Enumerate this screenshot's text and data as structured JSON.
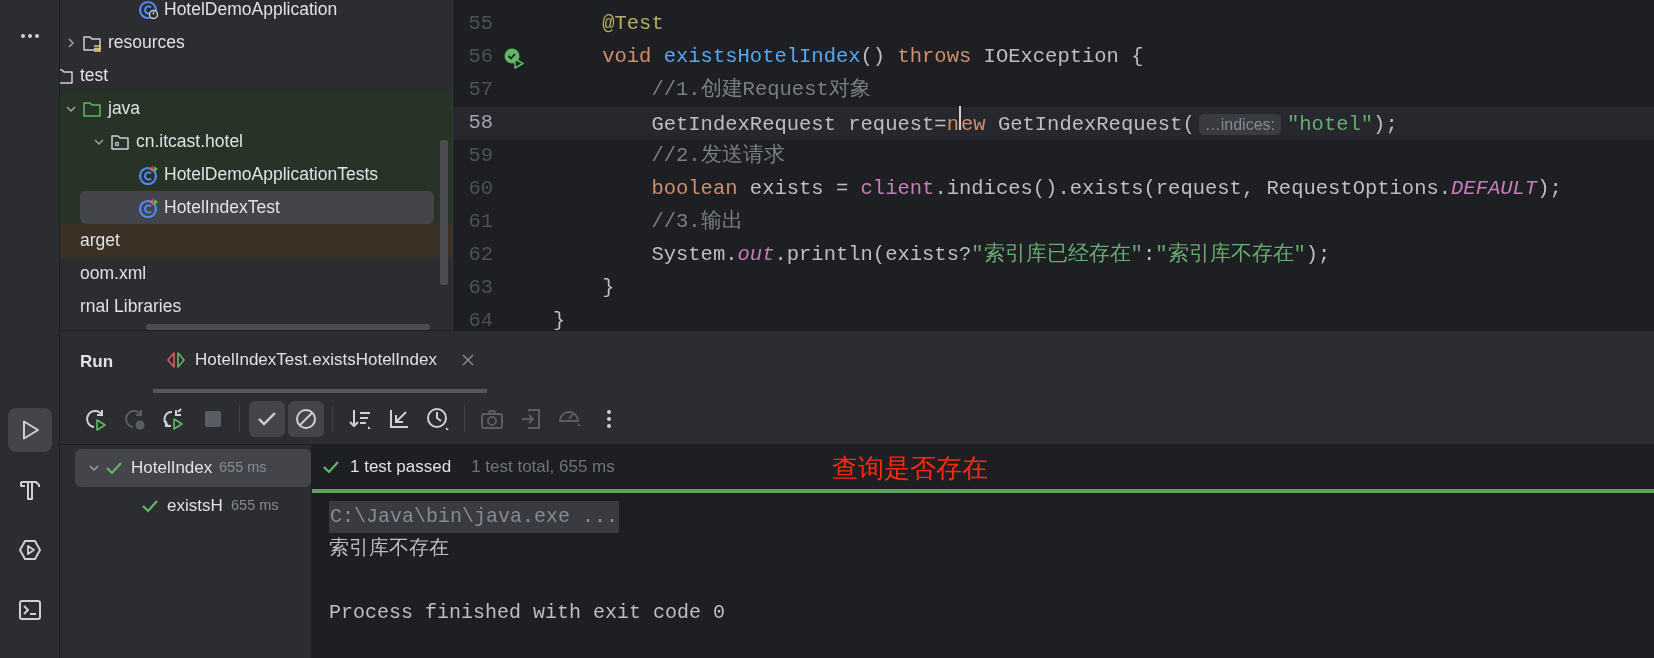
{
  "tool_windows": [
    {
      "kind": "more",
      "selected": false
    },
    {
      "kind": "run",
      "selected": true
    },
    {
      "kind": "build",
      "selected": false
    },
    {
      "kind": "services",
      "selected": false
    },
    {
      "kind": "terminal",
      "selected": false
    }
  ],
  "project_tree": [
    {
      "children": [
        {
          "children": [
            {
              "children": [
                {
                  "label": "HotelDemoApplication",
                  "kind": "app-class"
                }
              ]
            }
          ]
        },
        {
          "label": "resources",
          "kind": "resources-folder",
          "expanded": false
        }
      ]
    },
    {
      "label": "test",
      "kind": "folder",
      "children": [
        {
          "label": "java",
          "kind": "test-folder",
          "expanded": true,
          "children": [
            {
              "label": "cn.itcast.hotel",
              "kind": "package",
              "expanded": true,
              "children": [
                {
                  "label": "HotelDemoApplicationTests",
                  "kind": "test-class",
                  "selected": false
                },
                {
                  "label": "HotelIndexTest",
                  "kind": "test-class",
                  "selected": true
                }
              ]
            }
          ]
        }
      ]
    },
    {
      "label": "arget",
      "kind": "excluded-folder"
    },
    {
      "label": "oom.xml"
    },
    {
      "label": "rnal Libraries"
    }
  ],
  "editor": {
    "lines": [
      {
        "number": "55",
        "current": false,
        "tokens": [
          {
            "kind": "annotation",
            "text": "    @Test"
          }
        ]
      },
      {
        "number": "56",
        "current": false,
        "gutter": {
          "kind": "test-passed"
        },
        "tokens": [
          {
            "kind": "keyword",
            "text": "    void "
          },
          {
            "kind": "method",
            "text": "existsHotelIndex"
          },
          {
            "kind": "plain",
            "text": "() "
          },
          {
            "kind": "keyword",
            "text": "throws "
          },
          {
            "kind": "plain",
            "text": "IOException {"
          }
        ]
      },
      {
        "number": "57",
        "current": false,
        "tokens": [
          {
            "kind": "comment",
            "text": "        //1.创建Request对象"
          }
        ]
      },
      {
        "number": "58",
        "current": true,
        "tokens": [
          {
            "kind": "plain",
            "text": "        GetIndexRequest request="
          },
          {
            "kind": "keyword",
            "text": "n"
          },
          {
            "kind": "caret"
          },
          {
            "kind": "keyword",
            "text": "ew "
          },
          {
            "kind": "plain",
            "text": "GetIndexRequest("
          },
          {
            "kind": "hint",
            "text": "…indices:"
          },
          {
            "kind": "string",
            "text": "\"hotel\""
          },
          {
            "kind": "plain",
            "text": ");"
          }
        ]
      },
      {
        "number": "59",
        "current": false,
        "tokens": [
          {
            "kind": "comment",
            "text": "        //2.发送请求"
          }
        ]
      },
      {
        "number": "60",
        "current": false,
        "tokens": [
          {
            "kind": "keyword",
            "text": "        boolean "
          },
          {
            "kind": "plain",
            "text": "exists = "
          },
          {
            "kind": "field",
            "text": "client"
          },
          {
            "kind": "plain",
            "text": ".indices().exists(request, RequestOptions."
          },
          {
            "kind": "static",
            "text": "DEFAULT"
          },
          {
            "kind": "plain",
            "text": ");"
          }
        ]
      },
      {
        "number": "61",
        "current": false,
        "tokens": [
          {
            "kind": "comment",
            "text": "        //3.输出"
          }
        ]
      },
      {
        "number": "62",
        "current": false,
        "tokens": [
          {
            "kind": "plain",
            "text": "        System."
          },
          {
            "kind": "static",
            "text": "out"
          },
          {
            "kind": "plain",
            "text": ".println(exists?"
          },
          {
            "kind": "string",
            "text": "\"索引库已经存在\""
          },
          {
            "kind": "plain",
            "text": ":"
          },
          {
            "kind": "string",
            "text": "\"索引库不存在\""
          },
          {
            "kind": "plain",
            "text": ");"
          }
        ]
      },
      {
        "number": "63",
        "current": false,
        "tokens": [
          {
            "kind": "plain",
            "text": "    }"
          }
        ]
      },
      {
        "number": "64",
        "current": false,
        "tokens": [
          {
            "kind": "plain",
            "text": "}"
          }
        ]
      }
    ]
  },
  "run_panel": {
    "title": "Run",
    "tabs": [
      {
        "label": "HotelIndexTest.existsHotelIndex",
        "selected": true
      }
    ],
    "toolbar_groups": [
      [
        {
          "kind": "rerun",
          "disabled": false,
          "on": false
        },
        {
          "kind": "rerun-failed",
          "disabled": true,
          "on": false
        },
        {
          "kind": "auto-test",
          "disabled": false,
          "on": false
        },
        {
          "kind": "stop",
          "disabled": true,
          "on": false
        }
      ],
      [
        {
          "kind": "show-passed",
          "disabled": false,
          "on": true
        },
        {
          "kind": "show-ignored",
          "disabled": false,
          "on": true
        }
      ],
      [
        {
          "kind": "sort",
          "disabled": false,
          "on": false
        },
        {
          "kind": "collapse",
          "disabled": false,
          "on": false
        },
        {
          "kind": "history",
          "disabled": false,
          "on": false
        }
      ],
      [
        {
          "kind": "camera",
          "disabled": true,
          "on": false
        },
        {
          "kind": "import",
          "disabled": true,
          "on": false
        },
        {
          "kind": "gauge",
          "disabled": true,
          "on": false
        },
        {
          "kind": "more",
          "disabled": false,
          "on": false
        }
      ]
    ],
    "test_tree": [
      {
        "label": "HotelIndex",
        "time": "655 ms",
        "passed": true,
        "selected": true,
        "expanded": true,
        "children": [
          {
            "label": "existsH",
            "time": "655 ms",
            "passed": true,
            "selected": false
          }
        ]
      }
    ],
    "status": {
      "passed": true,
      "summary": "1 test passed",
      "detail": "1 test total, 655 ms",
      "level": 1
    },
    "annotation": "查询是否存在",
    "console": [
      {
        "kind": "command",
        "text": "C:\\Java\\bin\\java.exe ..."
      },
      {
        "kind": "output",
        "text": "索引库不存在"
      },
      {
        "kind": "blank"
      },
      {
        "kind": "output",
        "text": "Process finished with exit code 0"
      }
    ]
  }
}
